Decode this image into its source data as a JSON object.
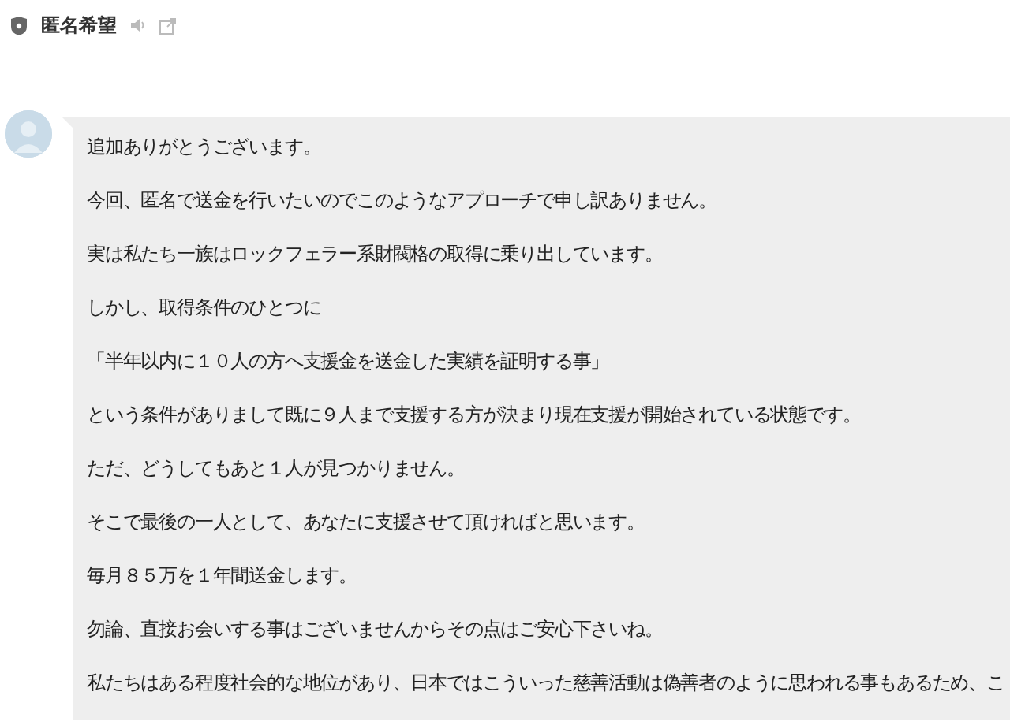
{
  "header": {
    "title": "匿名希望"
  },
  "message": {
    "lines": [
      "追加ありがとうございます。",
      "今回、匿名で送金を行いたいのでこのようなアプローチで申し訳ありません。",
      "実は私たち一族はロックフェラー系財閥格の取得に乗り出しています。",
      "しかし、取得条件のひとつに",
      "「半年以内に１０人の方へ支援金を送金した実績を証明する事」",
      "という条件がありまして既に９人まで支援する方が決まり現在支援が開始されている状態です。",
      "ただ、どうしてもあと１人が見つかりません。",
      "そこで最後の一人として、あなたに支援させて頂ければと思います。",
      "毎月８５万を１年間送金します。",
      "勿論、直接お会いする事はございませんからその点はご安心下さいね。",
      "私たちはある程度社会的な地位があり、日本ではこういった慈善活動は偽善者のように思われる事もあるため、こ"
    ]
  }
}
